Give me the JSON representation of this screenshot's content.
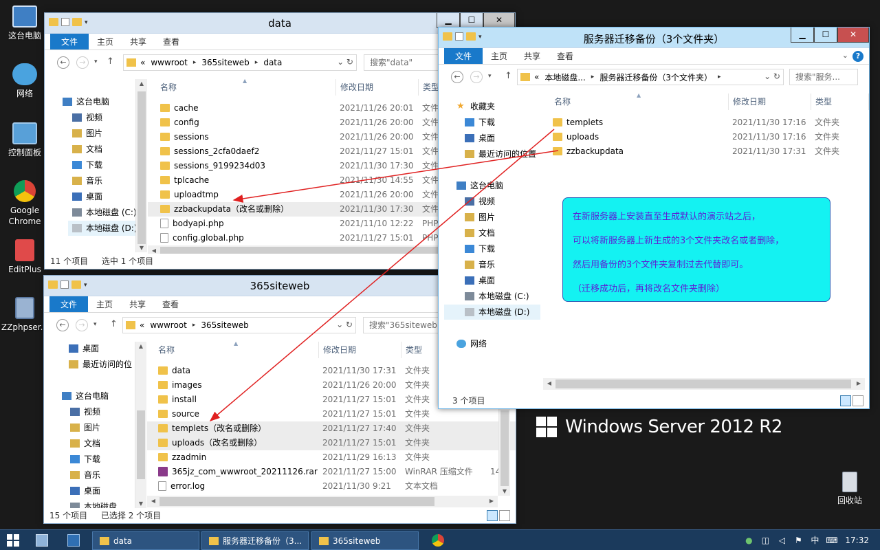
{
  "desktop": {
    "icons": [
      {
        "label": "这台电脑"
      },
      {
        "label": "网络"
      },
      {
        "label": "控制面板"
      },
      {
        "label": "Google Chrome"
      },
      {
        "label": "EditPlus"
      },
      {
        "label": "ZZphpser..."
      }
    ],
    "recycle_label": "回收站",
    "brand": "Windows Server 2012 R2"
  },
  "ribbon": {
    "file": "文件",
    "home": "主页",
    "share": "共享",
    "view": "查看"
  },
  "win_data": {
    "title": "data",
    "address": [
      "«",
      "wwwroot",
      "365siteweb",
      "data"
    ],
    "search_placeholder": "搜索\"data\"",
    "nav": [
      {
        "label": "这台电脑"
      },
      {
        "label": "视频"
      },
      {
        "label": "图片"
      },
      {
        "label": "文档"
      },
      {
        "label": "下载"
      },
      {
        "label": "音乐"
      },
      {
        "label": "桌面"
      },
      {
        "label": "本地磁盘 (C:)"
      },
      {
        "label": "本地磁盘 (D:)"
      }
    ],
    "columns": {
      "name": "名称",
      "date": "修改日期",
      "type": "类型"
    },
    "rows": [
      {
        "name": "cache",
        "date": "2021/11/26 20:01",
        "type": "文件"
      },
      {
        "name": "config",
        "date": "2021/11/26 20:00",
        "type": "文件"
      },
      {
        "name": "sessions",
        "date": "2021/11/26 20:00",
        "type": "文件"
      },
      {
        "name": "sessions_2cfa0daef2",
        "date": "2021/11/27 15:01",
        "type": "文件"
      },
      {
        "name": "sessions_9199234d03",
        "date": "2021/11/30 17:30",
        "type": "文件"
      },
      {
        "name": "tplcache",
        "date": "2021/11/30 14:55",
        "type": "文件"
      },
      {
        "name": "uploadtmp",
        "date": "2021/11/26 20:00",
        "type": "文件"
      },
      {
        "name": "zzbackupdata（改名或删除）",
        "date": "2021/11/30 17:30",
        "type": "文件"
      },
      {
        "name": "bodyapi.php",
        "date": "2021/11/10 12:22",
        "type": "PHP"
      },
      {
        "name": "config.global.php",
        "date": "2021/11/27 15:01",
        "type": "PHP"
      }
    ],
    "status_count": "11 个项目",
    "status_selected": "选中 1 个项目"
  },
  "win_site": {
    "title": "365siteweb",
    "address": [
      "«",
      "wwwroot",
      "365siteweb"
    ],
    "search_placeholder": "搜索\"365siteweb\"",
    "nav": [
      {
        "label": "桌面"
      },
      {
        "label": "最近访问的位"
      },
      {
        "label": "这台电脑"
      },
      {
        "label": "视频"
      },
      {
        "label": "图片"
      },
      {
        "label": "文档"
      },
      {
        "label": "下载"
      },
      {
        "label": "音乐"
      },
      {
        "label": "桌面"
      },
      {
        "label": "本地磁盘"
      }
    ],
    "columns": {
      "name": "名称",
      "date": "修改日期",
      "type": "类型"
    },
    "rows": [
      {
        "name": "data",
        "date": "2021/11/30 17:31",
        "type": "文件夹",
        "size": ""
      },
      {
        "name": "images",
        "date": "2021/11/26 20:00",
        "type": "文件夹",
        "size": ""
      },
      {
        "name": "install",
        "date": "2021/11/27 15:01",
        "type": "文件夹",
        "size": ""
      },
      {
        "name": "source",
        "date": "2021/11/27 15:01",
        "type": "文件夹",
        "size": ""
      },
      {
        "name": "templets（改名或删除）",
        "date": "2021/11/27 17:40",
        "type": "文件夹",
        "size": ""
      },
      {
        "name": "uploads（改名或删除）",
        "date": "2021/11/27 15:01",
        "type": "文件夹",
        "size": ""
      },
      {
        "name": "zzadmin",
        "date": "2021/11/29 16:13",
        "type": "文件夹",
        "size": ""
      },
      {
        "name": "365jz_com_wwwroot_20211126.rar",
        "date": "2021/11/27 15:00",
        "type": "WinRAR 压缩文件",
        "size": "14"
      },
      {
        "name": "error.log",
        "date": "2021/11/30 9:21",
        "type": "文本文档",
        "size": ""
      }
    ],
    "status_count": "15 个项目",
    "status_selected": "已选择 2 个项目"
  },
  "win_backup": {
    "title": "服务器迁移备份（3个文件夹）",
    "address": [
      "«",
      "本地磁盘...",
      "服务器迁移备份（3个文件夹）"
    ],
    "search_placeholder": "搜索\"服务...",
    "nav": [
      {
        "label": "收藏夹"
      },
      {
        "label": "下载"
      },
      {
        "label": "桌面"
      },
      {
        "label": "最近访问的位置"
      },
      {
        "label": "这台电脑"
      },
      {
        "label": "视频"
      },
      {
        "label": "图片"
      },
      {
        "label": "文档"
      },
      {
        "label": "下载"
      },
      {
        "label": "音乐"
      },
      {
        "label": "桌面"
      },
      {
        "label": "本地磁盘 (C:)"
      },
      {
        "label": "本地磁盘 (D:)"
      },
      {
        "label": "网络"
      }
    ],
    "columns": {
      "name": "名称",
      "date": "修改日期",
      "type": "类型"
    },
    "rows": [
      {
        "name": "templets",
        "date": "2021/11/30 17:16",
        "type": "文件夹"
      },
      {
        "name": "uploads",
        "date": "2021/11/30 17:16",
        "type": "文件夹"
      },
      {
        "name": "zzbackupdata",
        "date": "2021/11/30 17:31",
        "type": "文件夹"
      }
    ],
    "status_count": "3 个项目"
  },
  "note": {
    "line1": "在新服务器上安装直至生成默认的演示站之后，",
    "line2": "可以将新服务器上新生成的3个文件夹改名或者删除，",
    "line3": "然后用备份的3个文件夹复制过去代替即可。",
    "line4": "（迁移成功后，再将改名文件夹删除）"
  },
  "taskbar": {
    "items": [
      {
        "label": "data"
      },
      {
        "label": "服务器迁移备份（3..."
      },
      {
        "label": "365siteweb"
      }
    ],
    "ime": "中",
    "time": "17:32"
  },
  "colors": {
    "arrow": "#e02020",
    "note_bg": "#14f2f2",
    "note_text": "#5b21d6",
    "accent": "#1979ca"
  }
}
